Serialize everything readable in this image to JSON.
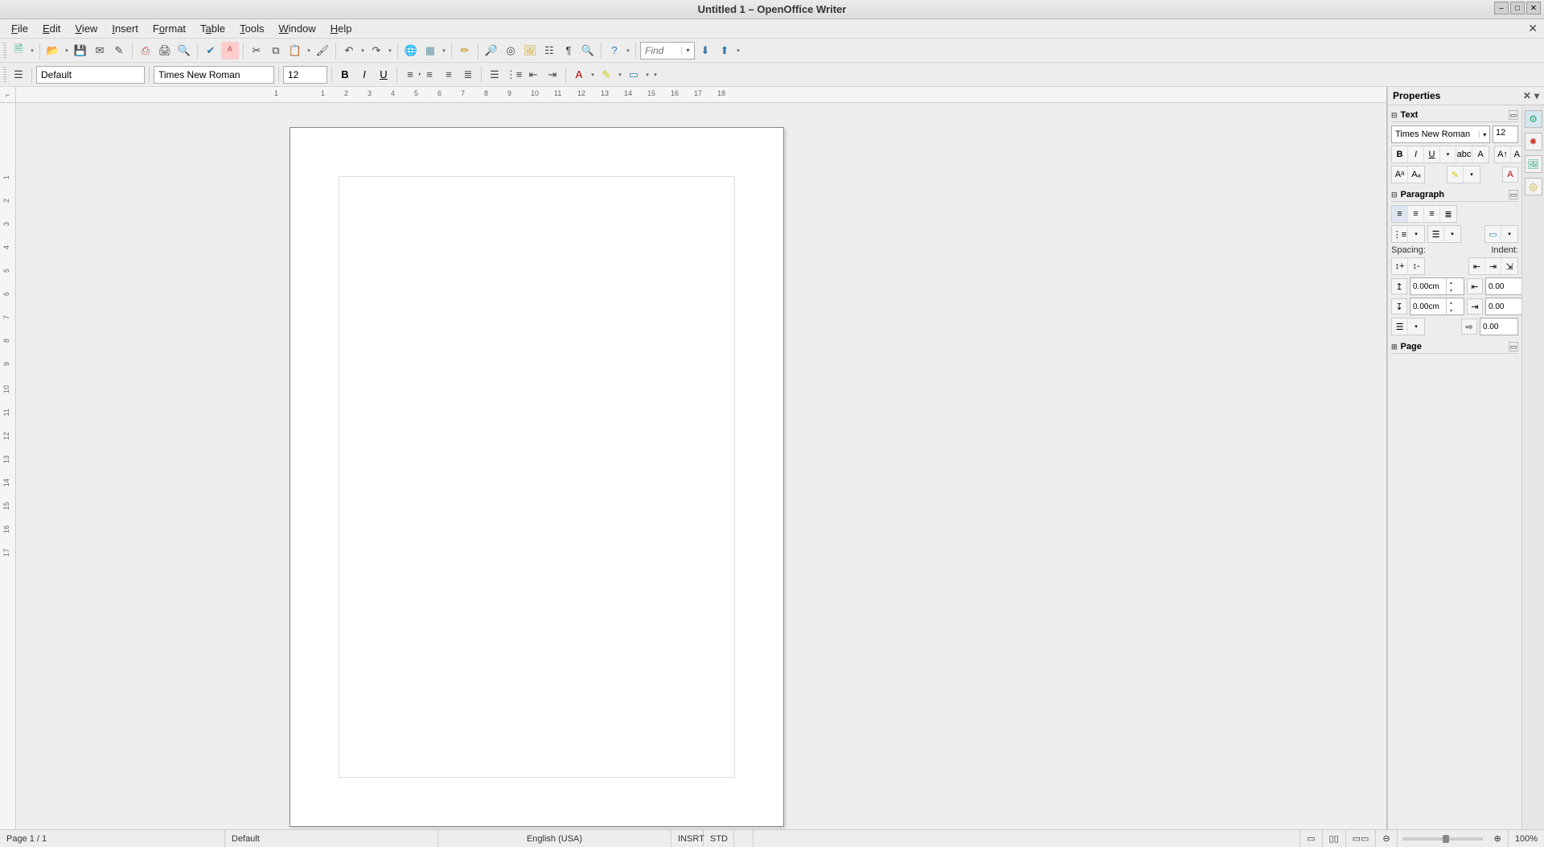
{
  "window": {
    "title": "Untitled 1 – OpenOffice Writer"
  },
  "menu": {
    "items": [
      {
        "label": "File",
        "u": "F"
      },
      {
        "label": "Edit",
        "u": "E"
      },
      {
        "label": "View",
        "u": "V"
      },
      {
        "label": "Insert",
        "u": "I"
      },
      {
        "label": "Format",
        "u": "F"
      },
      {
        "label": "Table",
        "u": "T"
      },
      {
        "label": "Tools",
        "u": "T"
      },
      {
        "label": "Window",
        "u": "W"
      },
      {
        "label": "Help",
        "u": "H"
      }
    ]
  },
  "toolbar1": {
    "find_placeholder": "Find"
  },
  "toolbar2": {
    "style": "Default",
    "font": "Times New Roman",
    "size": "12"
  },
  "ruler_h": [
    "1",
    "1",
    "2",
    "3",
    "4",
    "5",
    "6",
    "7",
    "8",
    "9",
    "10",
    "11",
    "12",
    "13",
    "14",
    "15",
    "16",
    "17",
    "18"
  ],
  "ruler_v": [
    "1",
    "2",
    "3",
    "4",
    "5",
    "6",
    "7",
    "8",
    "9",
    "10",
    "11",
    "12",
    "13",
    "14",
    "15",
    "16",
    "17"
  ],
  "sidebar": {
    "title": "Properties",
    "text": {
      "title": "Text",
      "font": "Times New Roman",
      "size": "12"
    },
    "paragraph": {
      "title": "Paragraph",
      "spacing_label": "Spacing:",
      "indent_label": "Indent:",
      "spacing_above": "0.00cm",
      "spacing_below": "0.00cm",
      "indent_left": "0.00",
      "indent_right": "0.00",
      "indent_first": "0.00"
    },
    "page": {
      "title": "Page"
    }
  },
  "status": {
    "page": "Page 1 / 1",
    "style": "Default",
    "lang": "English (USA)",
    "insert": "INSRT",
    "std": "STD",
    "zoom": "100%"
  }
}
